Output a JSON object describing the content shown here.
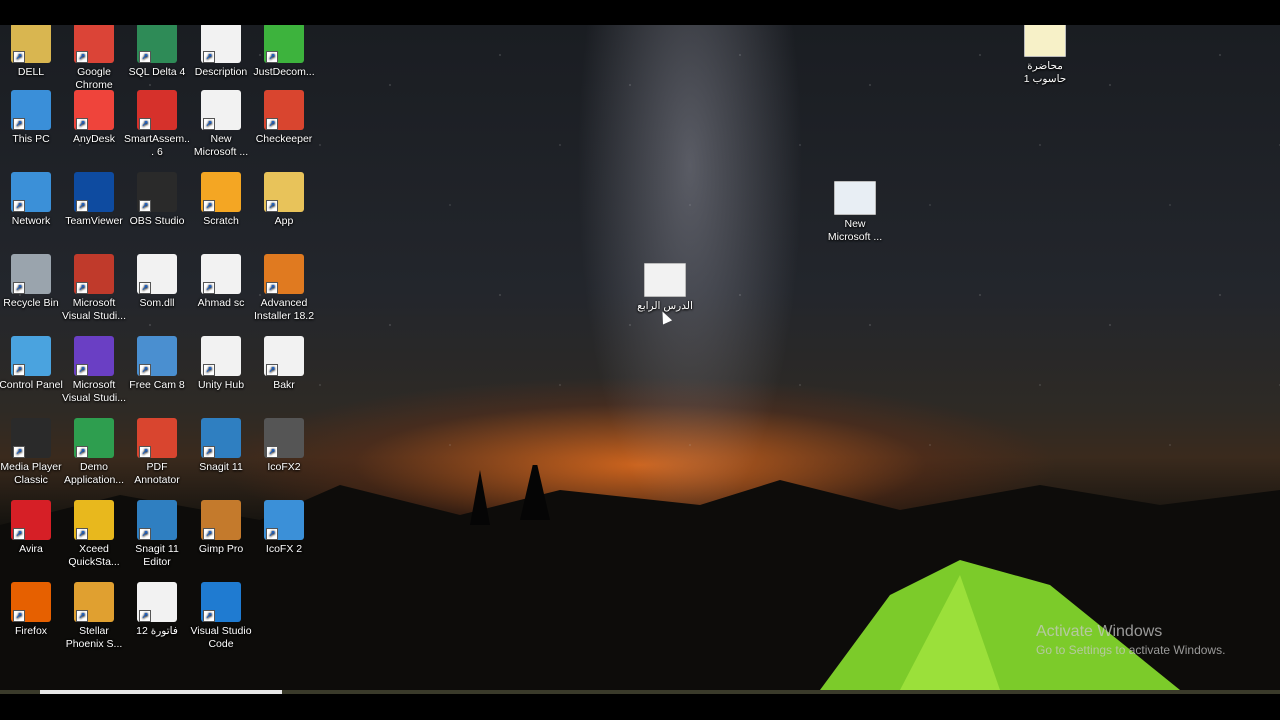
{
  "desktop": {
    "icons": [
      {
        "label": "DELL",
        "icon": "folder-user-icon",
        "color": "#d9b650"
      },
      {
        "label": "Google Chrome",
        "icon": "chrome-icon",
        "color": "#db4437"
      },
      {
        "label": "SQL Delta 4",
        "icon": "sql-delta-icon",
        "color": "#2e8b57"
      },
      {
        "label": "Description",
        "icon": "document-icon",
        "color": "#f2f2f2"
      },
      {
        "label": "JustDecom...",
        "icon": "justdecompile-icon",
        "color": "#3db33d"
      },
      {
        "label": "This PC",
        "icon": "computer-icon",
        "color": "#3a8fd9"
      },
      {
        "label": "AnyDesk",
        "icon": "anydesk-icon",
        "color": "#ef443b"
      },
      {
        "label": "SmartAssem... 6",
        "icon": "smartassembly-icon",
        "color": "#d6312b"
      },
      {
        "label": "New Microsoft ...",
        "icon": "word-document-icon",
        "color": "#f2f2f2"
      },
      {
        "label": "Checkeeper",
        "icon": "checkeeper-icon",
        "color": "#d9452f"
      },
      {
        "label": "Network",
        "icon": "network-icon",
        "color": "#3b90d8"
      },
      {
        "label": "TeamViewer",
        "icon": "teamviewer-icon",
        "color": "#0e4ba0"
      },
      {
        "label": "OBS Studio",
        "icon": "obs-icon",
        "color": "#2a2a2a"
      },
      {
        "label": "Scratch",
        "icon": "scratch-cat-icon",
        "color": "#f4a623"
      },
      {
        "label": "App",
        "icon": "folder-icon",
        "color": "#e8c35a"
      },
      {
        "label": "Recycle Bin",
        "icon": "recycle-bin-icon",
        "color": "#9aa4ad"
      },
      {
        "label": "Microsoft Visual Studi...",
        "icon": "visual-studio-installer-icon",
        "color": "#c03a2b"
      },
      {
        "label": "Som.dll",
        "icon": "dll-file-icon",
        "color": "#f2f2f2"
      },
      {
        "label": "Ahmad sc",
        "icon": "blank-file-icon",
        "color": "#f2f2f2"
      },
      {
        "label": "Advanced Installer 18.2",
        "icon": "advanced-installer-icon",
        "color": "#e07a20"
      },
      {
        "label": "Control Panel",
        "icon": "control-panel-icon",
        "color": "#4aa3df"
      },
      {
        "label": "Microsoft Visual Studi...",
        "icon": "visual-studio-icon",
        "color": "#6a3fc4"
      },
      {
        "label": "Free Cam 8",
        "icon": "free-cam-icon",
        "color": "#4a8fd0"
      },
      {
        "label": "Unity Hub",
        "icon": "unity-icon",
        "color": "#f2f2f2"
      },
      {
        "label": "Bakr",
        "icon": "blank-file-icon",
        "color": "#f2f2f2"
      },
      {
        "label": "Media Player Classic",
        "icon": "media-player-classic-icon",
        "color": "#2a2a2a"
      },
      {
        "label": "Demo Application...",
        "icon": "wf-demo-icon",
        "color": "#2e9e4f"
      },
      {
        "label": "PDF Annotator",
        "icon": "pdf-annotator-icon",
        "color": "#d9452f"
      },
      {
        "label": "Snagit 11",
        "icon": "snagit-icon",
        "color": "#2f7fc1"
      },
      {
        "label": "IcoFX2",
        "icon": "icofx-icon",
        "color": "#555555"
      },
      {
        "label": "Avira",
        "icon": "avira-icon",
        "color": "#d61f26"
      },
      {
        "label": "Xceed QuickSta...",
        "icon": "xceed-icon",
        "color": "#e8b81d"
      },
      {
        "label": "Snagit 11 Editor",
        "icon": "snagit-editor-icon",
        "color": "#2f7fc1"
      },
      {
        "label": "Gimp Pro",
        "icon": "gimp-icon",
        "color": "#c47a2c"
      },
      {
        "label": "IcoFX 2",
        "icon": "icofx2-icon",
        "color": "#3b90d8"
      },
      {
        "label": "Firefox",
        "icon": "firefox-icon",
        "color": "#e66000"
      },
      {
        "label": "Stellar Phoenix S...",
        "icon": "stellar-phoenix-icon",
        "color": "#e0a030"
      },
      {
        "label": "فاتورة 12",
        "icon": "word-document-icon",
        "color": "#f2f2f2"
      },
      {
        "label": "Visual Studio Code",
        "icon": "vscode-icon",
        "color": "#1f7bd1"
      }
    ],
    "loose_icons": [
      {
        "label": "محاضرة حاسوب 1",
        "icon": "powerpoint-file-icon",
        "color": "#f7f1c8"
      },
      {
        "label": "New Microsoft ...",
        "icon": "powerpoint-file-icon",
        "color": "#e8eef4"
      },
      {
        "label": "الدرس الرابع",
        "icon": "powerpoint-file-icon",
        "color": "#f2f2f2"
      }
    ]
  },
  "watermark": {
    "title": "Activate Windows",
    "subtitle": "Go to Settings to activate Windows."
  },
  "video_progress": 0.22
}
